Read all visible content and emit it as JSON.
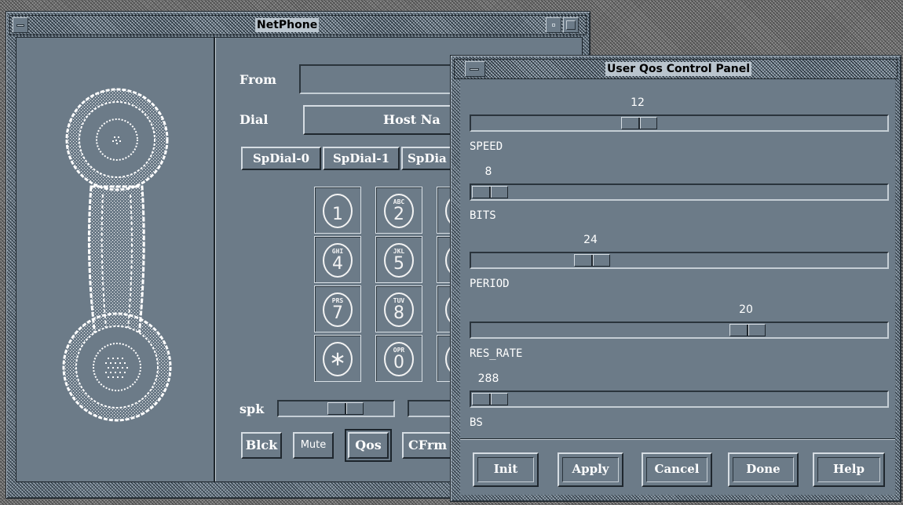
{
  "netphone": {
    "title": "NetPhone",
    "from_label": "From",
    "from_value": "",
    "dial_label": "Dial",
    "dial_value": "Host Na",
    "speed_dials": [
      "SpDial-0",
      "SpDial-1",
      "SpDia"
    ],
    "keypad": [
      {
        "digit": "1",
        "letters": ""
      },
      {
        "digit": "2",
        "letters": "ABC"
      },
      {
        "digit": "4",
        "letters": "GHI"
      },
      {
        "digit": "5",
        "letters": "JKL"
      },
      {
        "digit": "7",
        "letters": "PRS"
      },
      {
        "digit": "8",
        "letters": "TUV"
      },
      {
        "digit": "∗",
        "letters": ""
      },
      {
        "digit": "0",
        "letters": "OPR"
      }
    ],
    "spk_label": "spk",
    "spk_level": 0.62,
    "buttons": {
      "block": "Blck",
      "mute": "Mute",
      "qos": "Qos",
      "cfrm": "CFrm"
    }
  },
  "qos_panel": {
    "title": "User Qos Control Panel",
    "sliders": [
      {
        "label": "SPEED",
        "value": "12",
        "fraction": 0.395
      },
      {
        "label": "BITS",
        "value": "8",
        "fraction": 0.0
      },
      {
        "label": "PERIOD",
        "value": "24",
        "fraction": 0.27
      },
      {
        "label": "RES_RATE",
        "value": "20",
        "fraction": 0.68
      },
      {
        "label": "BS",
        "value": "288",
        "fraction": 0.0
      }
    ],
    "buttons": {
      "init": "Init",
      "apply": "Apply",
      "cancel": "Cancel",
      "done": "Done",
      "help": "Help"
    }
  },
  "colors": {
    "panel": "#6c7b88",
    "text": "#ffffff",
    "title_text_bg": "#b9c4cd"
  }
}
